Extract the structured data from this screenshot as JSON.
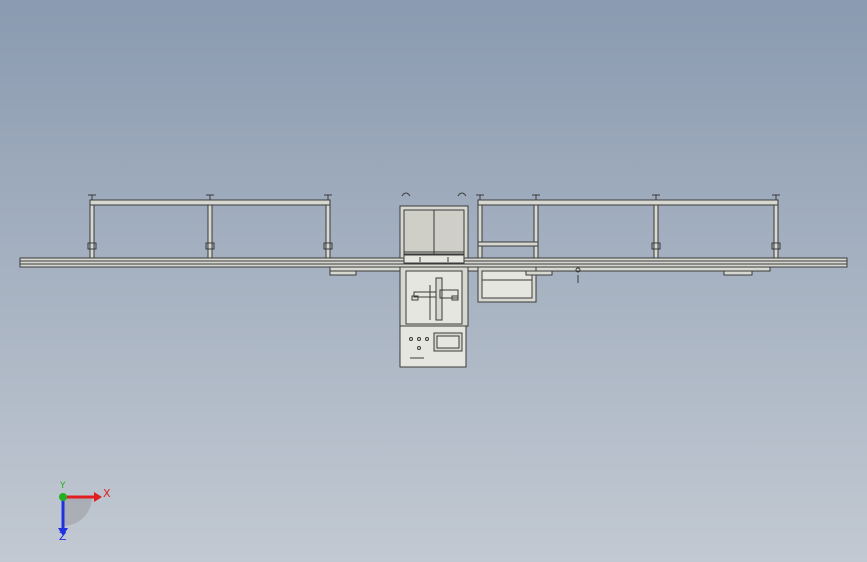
{
  "viewport": {
    "background_top": "#8a9ab0",
    "background_bottom": "#c2c9d2"
  },
  "model": {
    "line_color": "#3a3a3a",
    "fill_color": "#d8d8d2",
    "panel_fill": "#e6e6e0",
    "glass_fill": "#cfcfc8"
  },
  "triad": {
    "x_label": "X",
    "y_label": "Y",
    "z_label": "Z",
    "x_color": "#e02020",
    "y_color": "#20b020",
    "z_color": "#2030e0"
  }
}
